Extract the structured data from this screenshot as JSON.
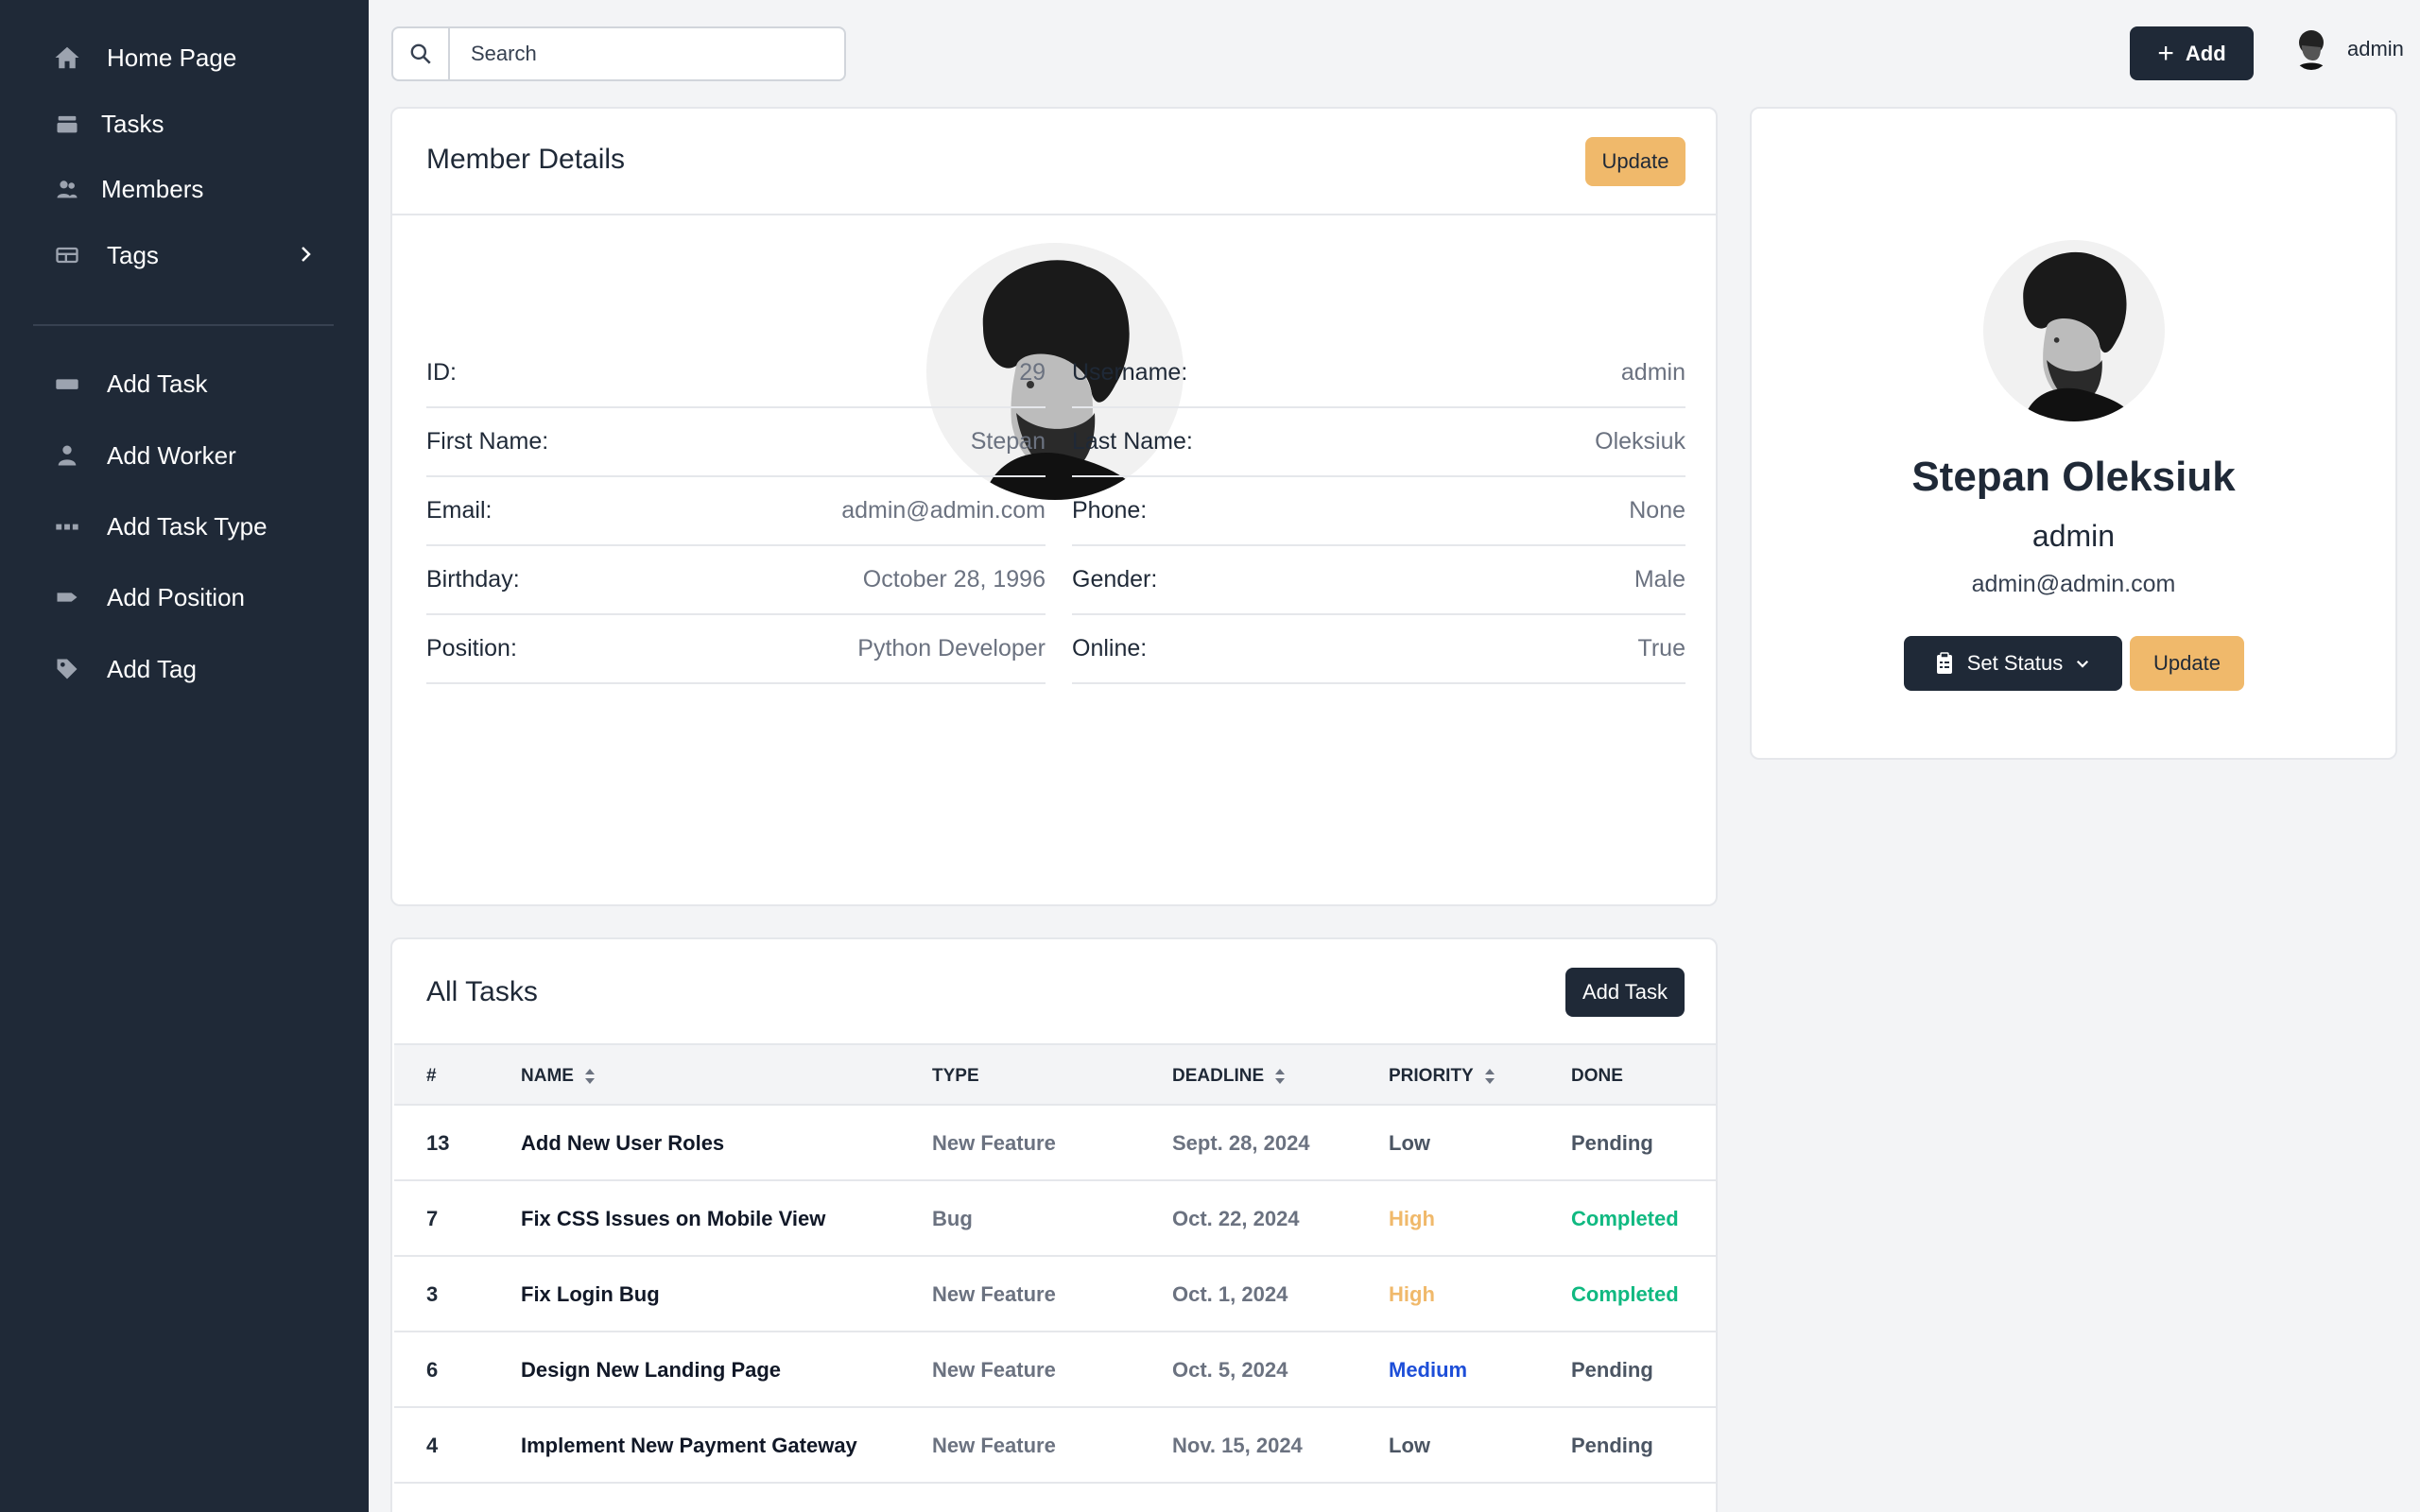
{
  "sidebar": {
    "items": [
      {
        "label": "Home Page",
        "icon": "home-icon"
      },
      {
        "label": "Tasks",
        "icon": "stack-icon"
      },
      {
        "label": "Members",
        "icon": "users-icon"
      },
      {
        "label": "Tags",
        "icon": "table-icon"
      },
      {
        "label": "Add Task",
        "icon": "add-task-icon"
      },
      {
        "label": "Add Worker",
        "icon": "user-icon"
      },
      {
        "label": "Add Task Type",
        "icon": "dots-icon"
      },
      {
        "label": "Add Position",
        "icon": "label-icon"
      },
      {
        "label": "Add Tag",
        "icon": "tag-icon"
      }
    ]
  },
  "topbar": {
    "search_placeholder": "Search",
    "add_label": "Add",
    "username": "admin"
  },
  "member_details": {
    "title": "Member Details",
    "update_label": "Update",
    "fields": [
      {
        "label": "ID:",
        "value": "29"
      },
      {
        "label": "Username:",
        "value": "admin"
      },
      {
        "label": "First Name:",
        "value": "Stepan"
      },
      {
        "label": "Last Name:",
        "value": "Oleksiuk"
      },
      {
        "label": "Email:",
        "value": "admin@admin.com"
      },
      {
        "label": "Phone:",
        "value": "None"
      },
      {
        "label": "Birthday:",
        "value": "October 28, 1996"
      },
      {
        "label": "Gender:",
        "value": "Male"
      },
      {
        "label": "Position:",
        "value": "Python Developer"
      },
      {
        "label": "Online:",
        "value": "True"
      }
    ]
  },
  "profile": {
    "full_name": "Stepan Oleksiuk",
    "username": "admin",
    "email": "admin@admin.com",
    "set_status_label": "Set Status",
    "update_label": "Update"
  },
  "tasks": {
    "title": "All Tasks",
    "add_task_label": "Add Task",
    "columns": [
      "#",
      "NAME",
      "TYPE",
      "DEADLINE",
      "PRIORITY",
      "DONE"
    ],
    "rows": [
      {
        "num": "13",
        "name": "Add New User Roles",
        "type": "New Feature",
        "deadline": "Sept. 28, 2024",
        "priority": "Low",
        "done": "Pending"
      },
      {
        "num": "7",
        "name": "Fix CSS Issues on Mobile View",
        "type": "Bug",
        "deadline": "Oct. 22, 2024",
        "priority": "High",
        "done": "Completed"
      },
      {
        "num": "3",
        "name": "Fix Login Bug",
        "type": "New Feature",
        "deadline": "Oct. 1, 2024",
        "priority": "High",
        "done": "Completed"
      },
      {
        "num": "6",
        "name": "Design New Landing Page",
        "type": "New Feature",
        "deadline": "Oct. 5, 2024",
        "priority": "Medium",
        "done": "Pending"
      },
      {
        "num": "4",
        "name": "Implement New Payment Gateway",
        "type": "New Feature",
        "deadline": "Nov. 15, 2024",
        "priority": "Low",
        "done": "Pending"
      }
    ]
  },
  "colors": {
    "sidebar_bg": "#1f2937",
    "accent_update": "#f0b96b",
    "priority_high": "#f0b96b",
    "priority_medium": "#1d4ed8",
    "priority_low": "#4b5563",
    "status_completed": "#10b981",
    "status_pending": "#4b5563"
  }
}
